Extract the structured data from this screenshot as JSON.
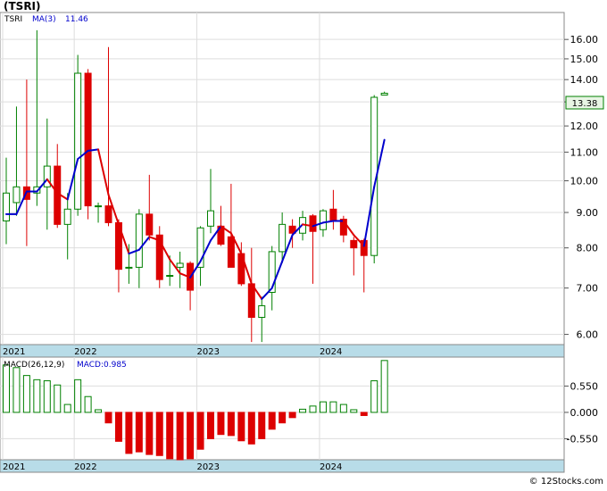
{
  "header": {
    "symbol": "(TSRI)"
  },
  "price_panel": {
    "legend_ticker": "TSRI",
    "legend_ma": "MA(3)",
    "legend_ma_value": "11.46",
    "last_price": "13.38"
  },
  "macd_panel": {
    "legend_name": "MACD(26,12,9)",
    "legend_value": "MACD:0.985"
  },
  "footer": {
    "watermark": "© 12Stocks.com"
  },
  "colors": {
    "bullish": "#008000",
    "bearish": "#dd0000",
    "ma_up": "#0000cc",
    "ma_down": "#dd0000",
    "axis_band": "#b8dce8",
    "price_tag": "#e8f5e4"
  },
  "chart_data": [
    {
      "type": "candlestick",
      "title": "TSRI",
      "y_scale": "log",
      "ylim": [
        5.8,
        17.5
      ],
      "y_ticks": [
        6.0,
        7.0,
        8.0,
        9.0,
        10.0,
        11.0,
        12.0,
        13.0,
        14.0,
        15.0,
        16.0
      ],
      "y_tick_labels": [
        "6.00",
        "7.00",
        "8.00",
        "9.00",
        "10.00",
        "11.00",
        "12.00",
        "13.00",
        "14.00",
        "15.00",
        "16.00"
      ],
      "x_labels": [
        {
          "label": "2021",
          "index": 0
        },
        {
          "label": "2022",
          "index": 7
        },
        {
          "label": "2023",
          "index": 19
        },
        {
          "label": "2024",
          "index": 31
        }
      ],
      "candles": [
        {
          "o": 8.75,
          "h": 10.8,
          "l": 8.1,
          "c": 9.6
        },
        {
          "o": 9.3,
          "h": 12.8,
          "l": 8.9,
          "c": 9.8
        },
        {
          "o": 9.8,
          "h": 14.0,
          "l": 8.05,
          "c": 9.4
        },
        {
          "o": 9.6,
          "h": 16.5,
          "l": 9.2,
          "c": 9.8
        },
        {
          "o": 9.8,
          "h": 12.3,
          "l": 8.5,
          "c": 10.5
        },
        {
          "o": 10.5,
          "h": 11.3,
          "l": 8.55,
          "c": 8.65
        },
        {
          "o": 8.65,
          "h": 9.6,
          "l": 7.7,
          "c": 9.1
        },
        {
          "o": 9.1,
          "h": 15.2,
          "l": 8.9,
          "c": 14.3
        },
        {
          "o": 14.3,
          "h": 14.5,
          "l": 8.8,
          "c": 9.2
        },
        {
          "o": 9.2,
          "h": 9.3,
          "l": 8.7,
          "c": 9.2
        },
        {
          "o": 9.2,
          "h": 15.6,
          "l": 8.6,
          "c": 8.7
        },
        {
          "o": 8.7,
          "h": 8.8,
          "l": 6.9,
          "c": 7.45
        },
        {
          "o": 7.5,
          "h": 8.1,
          "l": 7.1,
          "c": 7.5
        },
        {
          "o": 7.5,
          "h": 9.1,
          "l": 7.0,
          "c": 8.95
        },
        {
          "o": 8.95,
          "h": 10.2,
          "l": 8.2,
          "c": 8.35
        },
        {
          "o": 8.35,
          "h": 8.6,
          "l": 7.0,
          "c": 7.2
        },
        {
          "o": 7.3,
          "h": 7.8,
          "l": 7.05,
          "c": 7.3
        },
        {
          "o": 7.5,
          "h": 7.9,
          "l": 7.0,
          "c": 7.6
        },
        {
          "o": 7.6,
          "h": 7.65,
          "l": 6.5,
          "c": 6.95
        },
        {
          "o": 7.5,
          "h": 8.6,
          "l": 7.05,
          "c": 8.55
        },
        {
          "o": 8.6,
          "h": 10.4,
          "l": 8.4,
          "c": 9.05
        },
        {
          "o": 8.6,
          "h": 9.2,
          "l": 8.05,
          "c": 8.1
        },
        {
          "o": 8.3,
          "h": 9.9,
          "l": 7.6,
          "c": 7.5
        },
        {
          "o": 7.85,
          "h": 8.15,
          "l": 7.05,
          "c": 7.1
        },
        {
          "o": 7.1,
          "h": 8.0,
          "l": 5.85,
          "c": 6.35
        },
        {
          "o": 6.35,
          "h": 6.8,
          "l": 5.85,
          "c": 6.6
        },
        {
          "o": 6.9,
          "h": 8.05,
          "l": 6.5,
          "c": 7.9
        },
        {
          "o": 7.9,
          "h": 9.0,
          "l": 7.6,
          "c": 8.65
        },
        {
          "o": 8.6,
          "h": 8.8,
          "l": 8.0,
          "c": 8.4
        },
        {
          "o": 8.4,
          "h": 9.05,
          "l": 8.2,
          "c": 8.85
        },
        {
          "o": 8.9,
          "h": 8.95,
          "l": 7.1,
          "c": 8.45
        },
        {
          "o": 8.5,
          "h": 9.1,
          "l": 8.3,
          "c": 9.05
        },
        {
          "o": 9.1,
          "h": 9.7,
          "l": 8.5,
          "c": 8.75
        },
        {
          "o": 8.8,
          "h": 8.9,
          "l": 8.15,
          "c": 8.35
        },
        {
          "o": 8.2,
          "h": 8.3,
          "l": 7.3,
          "c": 8.0
        },
        {
          "o": 8.2,
          "h": 8.25,
          "l": 6.9,
          "c": 7.8
        },
        {
          "o": 7.8,
          "h": 13.3,
          "l": 7.6,
          "c": 13.2
        },
        {
          "o": 13.3,
          "h": 13.45,
          "l": 13.3,
          "c": 13.38
        }
      ],
      "ma": {
        "name": "MA(3)",
        "points": [
          {
            "i": 0,
            "v": 8.95
          },
          {
            "i": 1,
            "v": 8.95
          },
          {
            "i": 2,
            "v": 9.65
          },
          {
            "i": 3,
            "v": 9.65
          },
          {
            "i": 4,
            "v": 10.05
          },
          {
            "i": 5,
            "v": 9.6
          },
          {
            "i": 6,
            "v": 9.4
          },
          {
            "i": 7,
            "v": 10.75
          },
          {
            "i": 8,
            "v": 11.05
          },
          {
            "i": 9,
            "v": 11.1
          },
          {
            "i": 10,
            "v": 9.55
          },
          {
            "i": 11,
            "v": 8.65
          },
          {
            "i": 12,
            "v": 7.85
          },
          {
            "i": 13,
            "v": 7.95
          },
          {
            "i": 14,
            "v": 8.3
          },
          {
            "i": 15,
            "v": 8.2
          },
          {
            "i": 16,
            "v": 7.7
          },
          {
            "i": 17,
            "v": 7.35
          },
          {
            "i": 18,
            "v": 7.25
          },
          {
            "i": 19,
            "v": 7.65
          },
          {
            "i": 20,
            "v": 8.2
          },
          {
            "i": 21,
            "v": 8.6
          },
          {
            "i": 22,
            "v": 8.4
          },
          {
            "i": 23,
            "v": 7.85
          },
          {
            "i": 24,
            "v": 7.1
          },
          {
            "i": 25,
            "v": 6.75
          },
          {
            "i": 26,
            "v": 7.0
          },
          {
            "i": 27,
            "v": 7.65
          },
          {
            "i": 28,
            "v": 8.35
          },
          {
            "i": 29,
            "v": 8.65
          },
          {
            "i": 30,
            "v": 8.6
          },
          {
            "i": 31,
            "v": 8.7
          },
          {
            "i": 32,
            "v": 8.75
          },
          {
            "i": 33,
            "v": 8.75
          },
          {
            "i": 34,
            "v": 8.35
          },
          {
            "i": 35,
            "v": 8.05
          },
          {
            "i": 36,
            "v": 9.8
          },
          {
            "i": 37,
            "v": 11.46
          }
        ]
      }
    },
    {
      "type": "bar",
      "title": "MACD(26,12,9)",
      "ylim": [
        -0.9,
        1.05
      ],
      "y_ticks": [
        0.5,
        0.0,
        -0.5
      ],
      "y_tick_labels": [
        "0.550",
        "0.000",
        "-0.550"
      ],
      "x_labels": [
        {
          "label": "2021",
          "index": 0
        },
        {
          "label": "2022",
          "index": 7
        },
        {
          "label": "2023",
          "index": 19
        },
        {
          "label": "2024",
          "index": 31
        }
      ],
      "values": [
        0.9,
        0.85,
        0.7,
        0.62,
        0.6,
        0.52,
        0.15,
        0.62,
        0.3,
        0.05,
        -0.2,
        -0.55,
        -0.78,
        -0.75,
        -0.8,
        -0.82,
        -0.88,
        -0.9,
        -0.88,
        -0.7,
        -0.5,
        -0.42,
        -0.44,
        -0.54,
        -0.6,
        -0.5,
        -0.32,
        -0.2,
        -0.1,
        0.06,
        0.12,
        0.2,
        0.2,
        0.15,
        0.05,
        -0.06,
        0.6,
        0.985
      ]
    }
  ]
}
